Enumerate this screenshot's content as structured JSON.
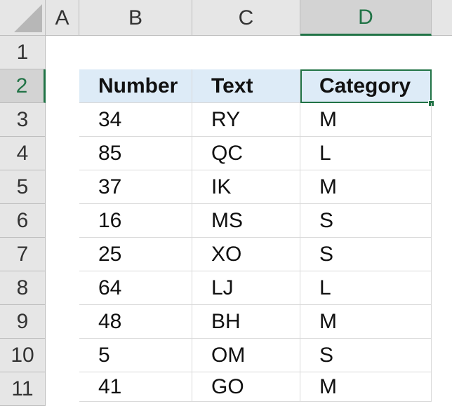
{
  "columns": [
    "A",
    "B",
    "C",
    "D"
  ],
  "rows": [
    "1",
    "2",
    "3",
    "4",
    "5",
    "6",
    "7",
    "8",
    "9",
    "10",
    "11"
  ],
  "table": {
    "headers": [
      "Number",
      "Text",
      "Category"
    ],
    "data": [
      [
        "34",
        "RY",
        "M"
      ],
      [
        "85",
        "QC",
        "L"
      ],
      [
        "37",
        "IK",
        "M"
      ],
      [
        "16",
        "MS",
        "S"
      ],
      [
        "25",
        "XO",
        "S"
      ],
      [
        "64",
        "LJ",
        "L"
      ],
      [
        "48",
        "BH",
        "M"
      ],
      [
        "5",
        "OM",
        "S"
      ],
      [
        "41",
        "GO",
        "M"
      ]
    ]
  },
  "selection": {
    "column": "D",
    "row": "2"
  },
  "colors": {
    "header_fill": "#ddebf7",
    "accent": "#217346",
    "header_bg": "#e6e6e6"
  }
}
